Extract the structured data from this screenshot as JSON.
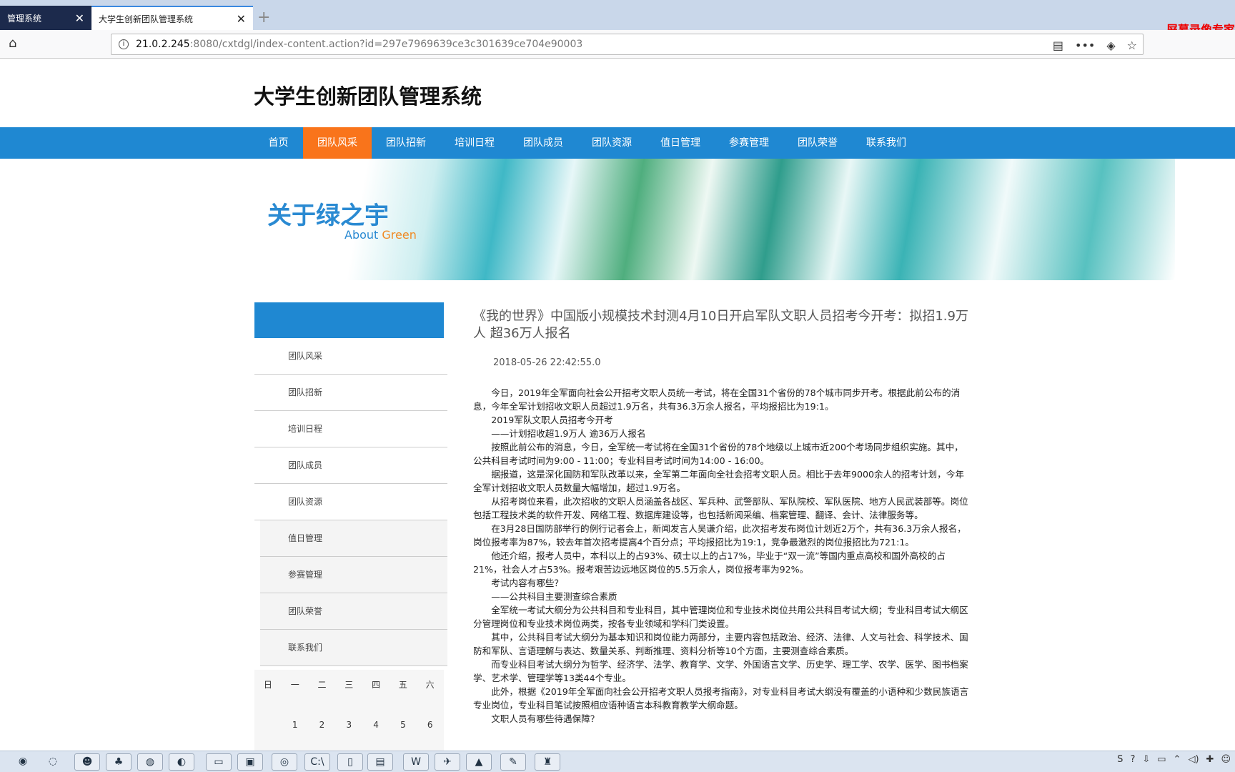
{
  "browser": {
    "tabs": [
      {
        "label": "管理系统",
        "active": false
      },
      {
        "label": "大学生创新团队管理系统",
        "active": true
      }
    ],
    "close_glyph": "✕",
    "new_tab_glyph": "+",
    "url_host": "21.0.2.245",
    "url_path": ":8080/cxtdgl/index-content.action?id=297e7969639ce3c301639ce704e90003",
    "recorder_watermark": "屏幕录像专家",
    "icons": {
      "home": "⌂",
      "info": "i",
      "reader": "▤",
      "more": "•••",
      "pocket": "◈",
      "bookmark": "☆"
    }
  },
  "site": {
    "title": "大学生创新团队管理系统",
    "nav": [
      "首页",
      "团队风采",
      "团队招新",
      "培训日程",
      "团队成员",
      "团队资源",
      "值日管理",
      "参赛管理",
      "团队荣誉",
      "联系我们"
    ],
    "nav_active": "团队风采",
    "banner": {
      "title": "关于绿之宇",
      "sub_a": "About",
      "sub_b": "Green"
    },
    "sidebar": [
      "团队风采",
      "团队招新",
      "培训日程",
      "团队成员",
      "团队资源",
      "值日管理",
      "参赛管理",
      "团队荣誉",
      "联系我们"
    ],
    "calendar": {
      "weekdays": [
        "日",
        "一",
        "二",
        "三",
        "四",
        "五",
        "六"
      ],
      "days": [
        "",
        "1",
        "2",
        "3",
        "4",
        "5",
        "6"
      ]
    },
    "colors": {
      "nav_blue": "#1f88d2",
      "nav_active": "#f9741b",
      "banner_title": "#2a8ad2",
      "banner_green": "#f08a24"
    }
  },
  "article": {
    "title": "《我的世界》中国版小规模技术封测4月10日开启军队文职人员招考今开考：拟招1.9万人 超36万人报名",
    "date": "2018-05-26 22:42:55.0",
    "paragraphs": [
      "今日，2019年全军面向社会公开招考文职人员统一考试，将在全国31个省份的78个城市同步开考。根据此前公布的消息，今年全军计划招收文职人员超过1.9万名，共有36.3万余人报名，平均报招比为19:1。",
      "2019军队文职人员招考今开考",
      "——计划招收超1.9万人 逾36万人报名",
      "按照此前公布的消息，今日，全军统一考试将在全国31个省份的78个地级以上城市近200个考场同步组织实施。其中，公共科目考试时间为9:00 - 11:00；专业科目考试时间为14:00 - 16:00。",
      "据报道，这是深化国防和军队改革以来，全军第二年面向全社会招考文职人员。相比于去年9000余人的招考计划，今年全军计划招收文职人员数量大幅增加，超过1.9万名。",
      "从招考岗位来看，此次招收的文职人员涵盖各战区、军兵种、武警部队、军队院校、军队医院、地方人民武装部等。岗位包括工程技术类的软件开发、网络工程、数据库建设等，也包括新闻采编、档案管理、翻译、会计、法律服务等。",
      "在3月28日国防部举行的例行记者会上，新闻发言人吴谦介绍，此次招考发布岗位计划近2万个，共有36.3万余人报名，岗位报考率为87%，较去年首次招考提高4个百分点；平均报招比为19:1，竞争最激烈的岗位报招比为721:1。",
      "他还介绍，报考人员中，本科以上的占93%、硕士以上的占17%，毕业于“双一流”等国内重点高校和国外高校的占21%，社会人才占53%。报考艰苦边远地区岗位的5.5万余人，岗位报考率为92%。",
      "考试内容有哪些？",
      "——公共科目主要测查综合素质",
      "全军统一考试大纲分为公共科目和专业科目，其中管理岗位和专业技术岗位共用公共科目考试大纲；专业科目考试大纲区分管理岗位和专业技术岗位两类，按各专业领域和学科门类设置。",
      "其中，公共科目考试大纲分为基本知识和岗位能力两部分，主要内容包括政治、经济、法律、人文与社会、科学技术、国防和军队、言语理解与表达、数量关系、判断推理、资料分析等10个方面，主要测查综合素质。",
      "而专业科目考试大纲分为哲学、经济学、法学、教育学、文学、外国语言文学、历史学、理工学、农学、医学、图书档案学、艺术学、管理学等13类44个专业。",
      "此外，根据《2019年全军面向社会公开招考文职人员报考指南》，对专业科目考试大纲没有覆盖的小语种和少数民族语言专业岗位，专业科目笔试按照相应语种语言本科教育教学大纲命题。",
      "文职人员有哪些待遇保障？"
    ]
  },
  "taskbar": {
    "buttons": [
      "◉",
      "◌",
      "☻",
      "♣",
      "◍",
      "◐",
      "▭",
      "▣",
      "◎",
      "C:\\",
      "▯",
      "▤",
      "W",
      "✈",
      "▲",
      "✎",
      "♜"
    ],
    "tray": [
      "S",
      "?",
      "⇩",
      "▭",
      "⌃",
      "◁)",
      "✚",
      "☺"
    ]
  }
}
